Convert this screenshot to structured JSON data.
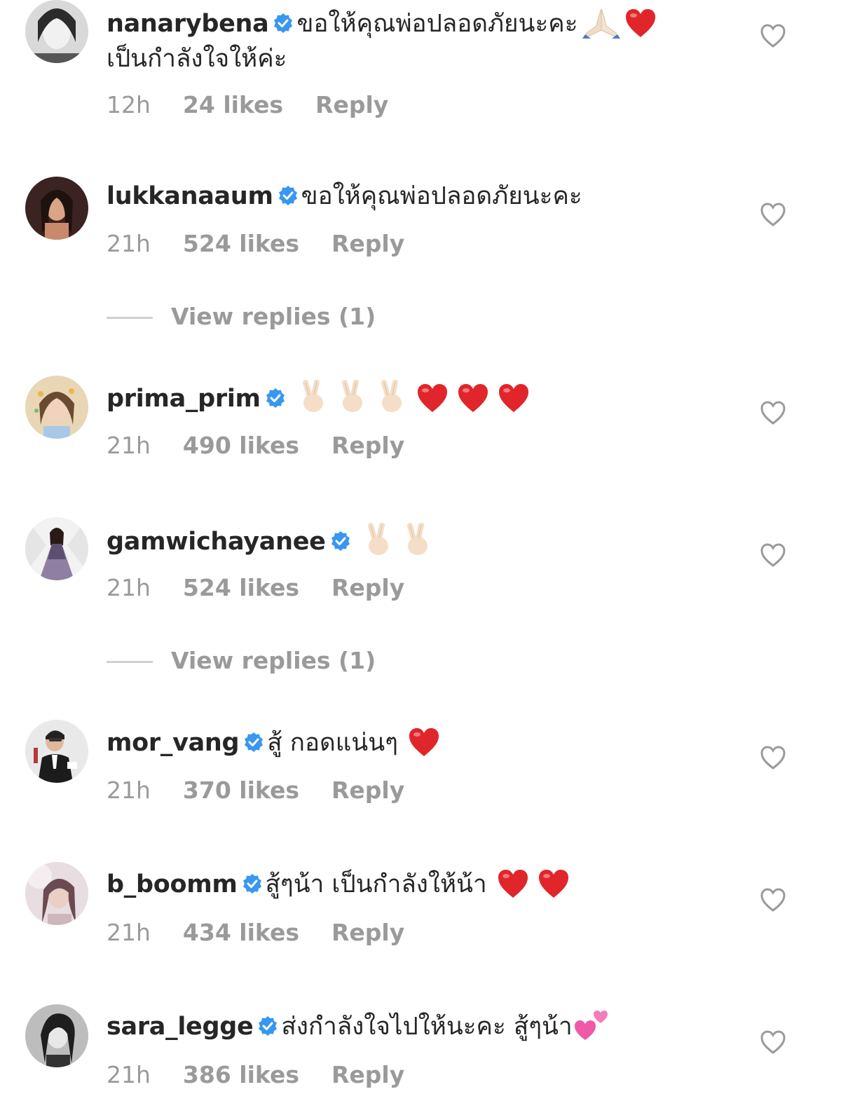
{
  "colors": {
    "username": "#262626",
    "text": "#262626",
    "meta": "#9a9a9a",
    "verified_badge": "#3897f0",
    "heart_outline": "#9a9a9a",
    "emoji_heart": "#e0262b",
    "background": "#ffffff"
  },
  "comments": [
    {
      "username": "nanarybena",
      "verified": true,
      "text": "ขอให้คุณพ่อปลอดภัยนะคะ",
      "emojis": [
        "folded-hands-icon",
        "red-heart-icon"
      ],
      "text_line2": "เป็นกำลังใจให้ค่ะ",
      "time": "12h",
      "likes": "24 likes",
      "reply_label": "Reply"
    },
    {
      "username": "lukkanaaum",
      "verified": true,
      "text": "ขอให้คุณพ่อปลอดภัยนะคะ",
      "emojis": [],
      "time": "21h",
      "likes": "524 likes",
      "reply_label": "Reply",
      "view_replies": "View replies (1)"
    },
    {
      "username": "prima_prim",
      "verified": true,
      "text": "",
      "emojis": [
        "victory-hand-icon",
        "victory-hand-icon",
        "victory-hand-icon",
        "red-heart-icon",
        "red-heart-icon",
        "red-heart-icon"
      ],
      "time": "21h",
      "likes": "490 likes",
      "reply_label": "Reply"
    },
    {
      "username": "gamwichayanee",
      "verified": true,
      "text": "",
      "emojis": [
        "victory-hand-icon",
        "victory-hand-icon"
      ],
      "time": "21h",
      "likes": "524 likes",
      "reply_label": "Reply",
      "view_replies": "View replies (1)"
    },
    {
      "username": "mor_vang",
      "verified": true,
      "text": "สู้ กอดแน่นๆ",
      "emojis": [
        "red-heart-icon"
      ],
      "time": "21h",
      "likes": "370 likes",
      "reply_label": "Reply"
    },
    {
      "username": "b_boomm",
      "verified": true,
      "text": "สู้ๆน้า เป็นกำลังให้น้า",
      "emojis": [
        "red-heart-icon",
        "red-heart-icon"
      ],
      "time": "21h",
      "likes": "434 likes",
      "reply_label": "Reply"
    },
    {
      "username": "sara_legge",
      "verified": true,
      "text": "ส่งกำลังใจไปให้นะคะ สู้ๆน้า",
      "emojis": [
        "two-hearts-icon"
      ],
      "time": "21h",
      "likes": "386 likes",
      "reply_label": "Reply"
    }
  ]
}
